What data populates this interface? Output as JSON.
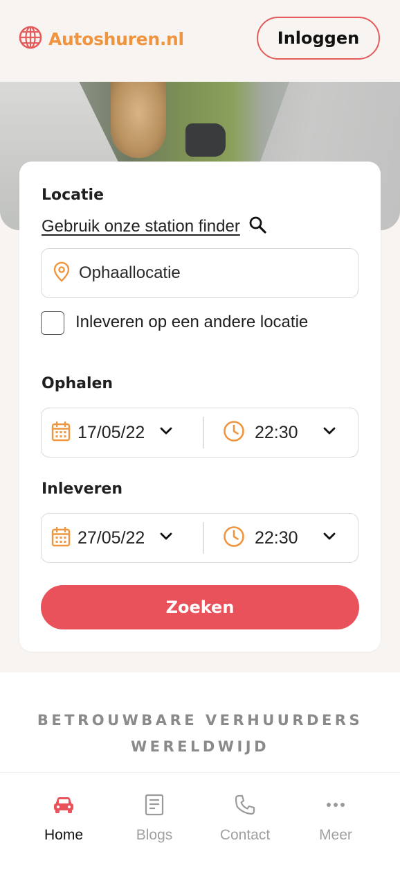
{
  "header": {
    "brand": "Autoshuren.nl",
    "login_label": "Inloggen"
  },
  "search_form": {
    "location_label": "Locatie",
    "station_finder_link": "Gebruik onze station finder",
    "pickup_location_placeholder": "Ophaallocatie",
    "different_return_label": "Inleveren op een andere locatie",
    "different_return_checked": false,
    "pickup": {
      "label": "Ophalen",
      "date": "17/05/22",
      "time": "22:30"
    },
    "return": {
      "label": "Inleveren",
      "date": "27/05/22",
      "time": "22:30"
    },
    "search_button": "Zoeken"
  },
  "tagline": {
    "line1": "BETROUWBARE VERHUURDERS",
    "line2": "WERELDWIJD"
  },
  "bottom_nav": {
    "items": [
      {
        "label": "Home",
        "icon": "car-icon",
        "active": true
      },
      {
        "label": "Blogs",
        "icon": "document-icon",
        "active": false
      },
      {
        "label": "Contact",
        "icon": "phone-icon",
        "active": false
      },
      {
        "label": "Meer",
        "icon": "more-icon",
        "active": false
      }
    ]
  },
  "colors": {
    "brand_orange": "#f0953f",
    "accent_red": "#e9525a",
    "background": "#f8f4f1"
  }
}
